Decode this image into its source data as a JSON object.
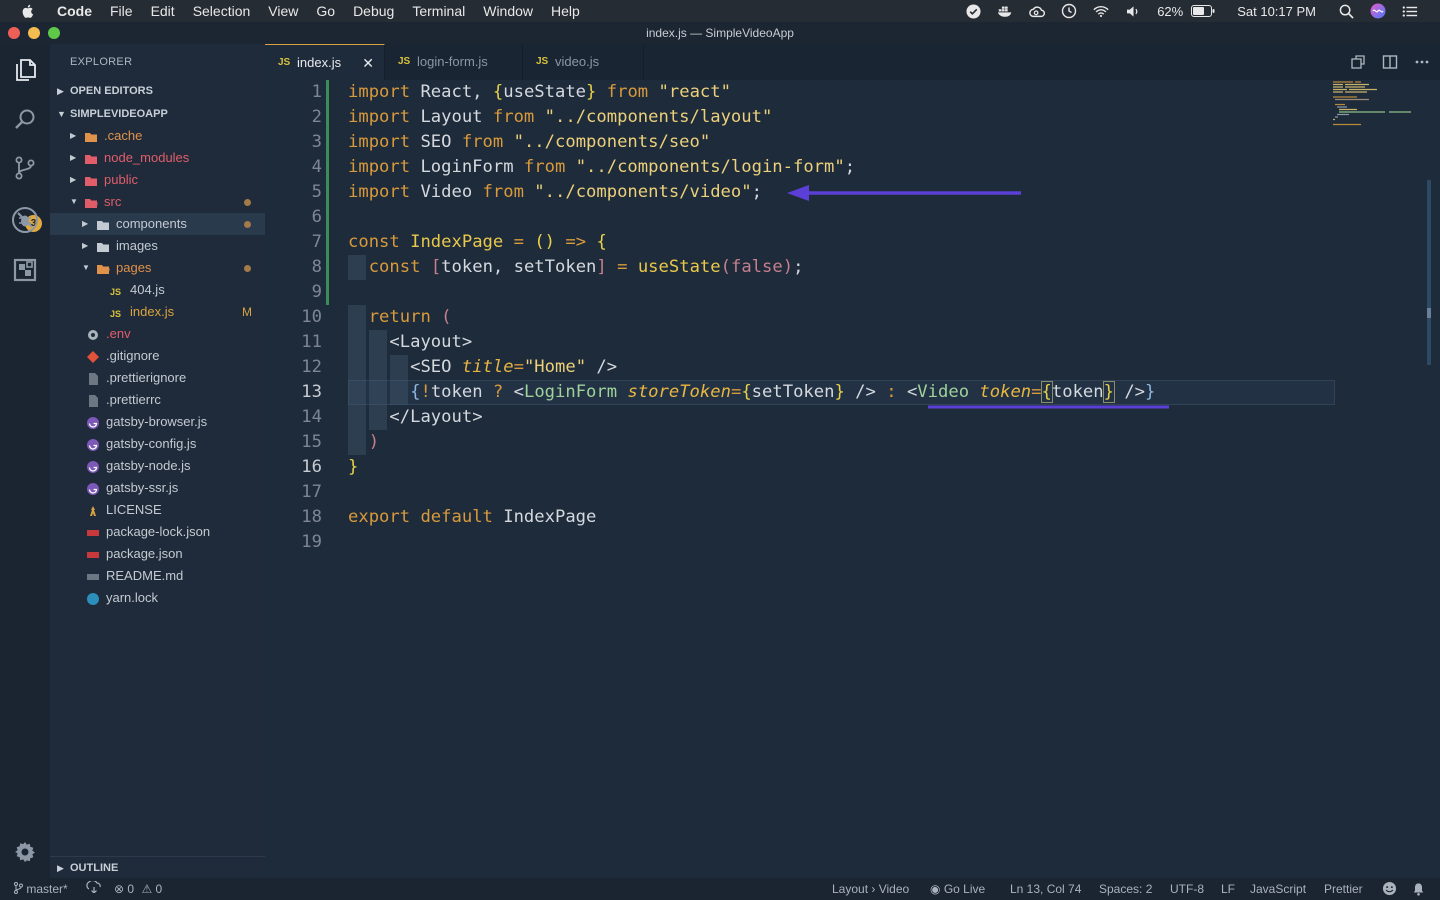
{
  "menubar": {
    "app_name": "Code",
    "menus": [
      "File",
      "Edit",
      "Selection",
      "View",
      "Go",
      "Debug",
      "Terminal",
      "Window",
      "Help"
    ],
    "battery": "62%",
    "clock": "Sat 10:17 PM"
  },
  "window": {
    "title": "index.js — SimpleVideoApp"
  },
  "activitybar": {
    "scm_badge": "3"
  },
  "sidebar": {
    "title": "EXPLORER",
    "open_editors": "OPEN EDITORS",
    "project": "SIMPLEVIDEOAPP",
    "outline": "OUTLINE",
    "tree": [
      {
        "label": ".cache",
        "type": "folder",
        "depth": 1,
        "color": "#e0914a"
      },
      {
        "label": "node_modules",
        "type": "folder",
        "depth": 1,
        "color": "#e15d6a"
      },
      {
        "label": "public",
        "type": "folder",
        "depth": 1,
        "color": "#e15d6a"
      },
      {
        "label": "src",
        "type": "folder-open",
        "depth": 1,
        "color": "#e15d6a"
      },
      {
        "label": "components",
        "type": "folder",
        "depth": 2,
        "color": "#c4cad2"
      },
      {
        "label": "images",
        "type": "folder",
        "depth": 2,
        "color": "#c4cad2"
      },
      {
        "label": "pages",
        "type": "folder-open",
        "depth": 2,
        "color": "#e0914a"
      },
      {
        "label": "404.js",
        "type": "js",
        "depth": 3,
        "color": "#c4cad2"
      },
      {
        "label": "index.js",
        "type": "js",
        "depth": 3,
        "color": "#d9a440",
        "status": "M"
      },
      {
        "label": ".env",
        "type": "gear",
        "depth": 1,
        "color": "#e15d6a"
      },
      {
        "label": ".gitignore",
        "type": "git",
        "depth": 1,
        "color": "#c4cad2"
      },
      {
        "label": ".prettierignore",
        "type": "file",
        "depth": 1,
        "color": "#c4cad2"
      },
      {
        "label": ".prettierrc",
        "type": "file",
        "depth": 1,
        "color": "#c4cad2"
      },
      {
        "label": "gatsby-browser.js",
        "type": "gatsby",
        "depth": 1,
        "color": "#c4cad2"
      },
      {
        "label": "gatsby-config.js",
        "type": "gatsby",
        "depth": 1,
        "color": "#c4cad2"
      },
      {
        "label": "gatsby-node.js",
        "type": "gatsby",
        "depth": 1,
        "color": "#c4cad2"
      },
      {
        "label": "gatsby-ssr.js",
        "type": "gatsby",
        "depth": 1,
        "color": "#c4cad2"
      },
      {
        "label": "LICENSE",
        "type": "license",
        "depth": 1,
        "color": "#c4cad2"
      },
      {
        "label": "package-lock.json",
        "type": "npm",
        "depth": 1,
        "color": "#c4cad2"
      },
      {
        "label": "package.json",
        "type": "npm",
        "depth": 1,
        "color": "#c4cad2"
      },
      {
        "label": "README.md",
        "type": "md",
        "depth": 1,
        "color": "#c4cad2"
      },
      {
        "label": "yarn.lock",
        "type": "yarn",
        "depth": 1,
        "color": "#c4cad2"
      }
    ]
  },
  "tabs": [
    {
      "icon": "JS",
      "label": "index.js",
      "active": true
    },
    {
      "icon": "JS",
      "label": "login-form.js",
      "active": false
    },
    {
      "icon": "JS",
      "label": "video.js",
      "active": false
    }
  ],
  "editor": {
    "line_numbers": [
      "1",
      "2",
      "3",
      "4",
      "5",
      "6",
      "7",
      "8",
      "9",
      "10",
      "11",
      "12",
      "13",
      "14",
      "15",
      "16",
      "17",
      "18",
      "19"
    ],
    "current_line": 13
  },
  "statusbar": {
    "branch": "master*",
    "errors": "0",
    "warnings": "0",
    "breadcrumb": "Layout › Video",
    "go_live": "Go Live",
    "position": "Ln 13, Col 74",
    "spaces": "Spaces: 2",
    "encoding": "UTF-8",
    "eol": "LF",
    "language": "JavaScript",
    "formatter": "Prettier"
  },
  "colors": {
    "accent": "#d9a440",
    "annotation": "#5b3fd6",
    "git_added": "#3d8a5b"
  }
}
